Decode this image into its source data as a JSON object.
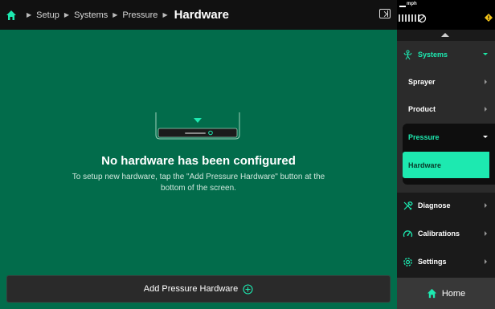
{
  "breadcrumb": {
    "items": [
      "Setup",
      "Systems",
      "Pressure"
    ],
    "current": "Hardware"
  },
  "status": {
    "speed_label": "mph"
  },
  "empty_state": {
    "title": "No hardware has been configured",
    "description": "To setup new hardware, tap the \"Add Pressure Hardware\" button at the bottom of the screen."
  },
  "add_button": {
    "label": "Add Pressure Hardware"
  },
  "nav": {
    "systems": "Systems",
    "sprayer": "Sprayer",
    "product": "Product",
    "pressure": "Pressure",
    "hardware": "Hardware",
    "diagnose": "Diagnose",
    "calibrations": "Calibrations",
    "settings": "Settings",
    "home": "Home"
  },
  "colors": {
    "accent": "#1de9b0",
    "main_bg": "#026c4b",
    "header_bg": "#111111",
    "warning": "#f5c518"
  },
  "icons": [
    "home-icon",
    "panel-toggle-icon",
    "signal-icon",
    "gps-icon",
    "warning-icon",
    "systems-icon",
    "diagnose-icon",
    "calibrations-icon",
    "settings-icon",
    "add-circle-icon"
  ]
}
